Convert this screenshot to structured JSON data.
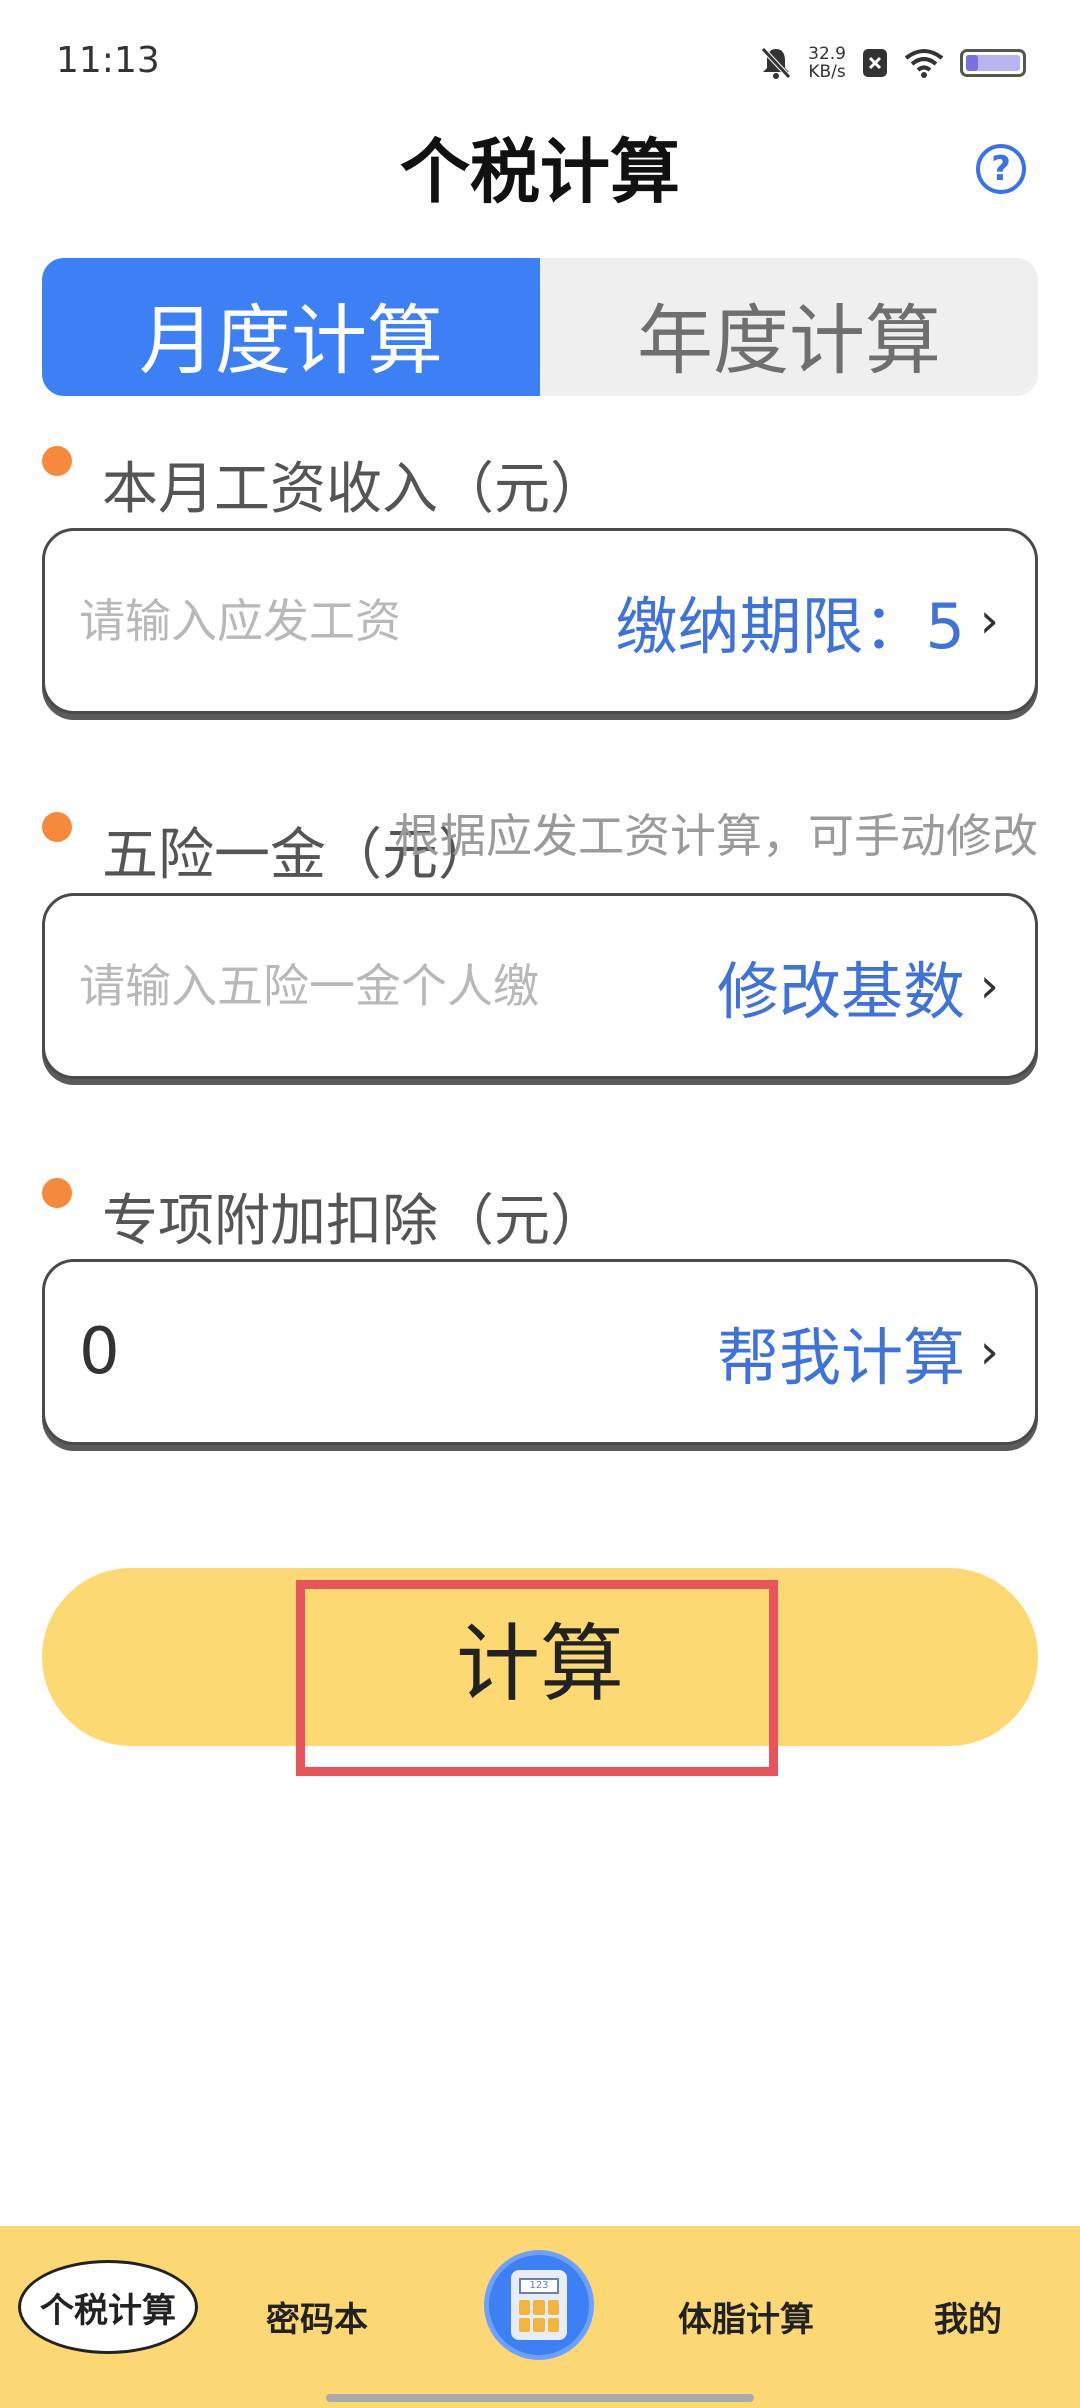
{
  "status_bar": {
    "time": "11:13",
    "speed_value": "32.9",
    "speed_unit": "KB/s"
  },
  "header": {
    "title": "个税计算",
    "help": "?"
  },
  "tabs": [
    {
      "label": "月度计算",
      "active": true
    },
    {
      "label": "年度计算",
      "active": false
    }
  ],
  "salary": {
    "label": "本月工资收入（元）",
    "placeholder": "请输入应发工资",
    "action": "缴纳期限：5"
  },
  "insurance": {
    "label": "五险一金（元）",
    "hint": "根据应发工资计算，可手动修改",
    "placeholder": "请输入五险一金个人缴",
    "action": "修改基数"
  },
  "deduction": {
    "label": "专项附加扣除（元）",
    "value": "0",
    "action": "帮我计算"
  },
  "calculate_button": "计算",
  "bottom_nav": {
    "items": [
      "个税计算",
      "密码本",
      "体脂计算",
      "我的"
    ],
    "center_icon_text": "123"
  },
  "colors": {
    "accent": "#3d7ff5",
    "button": "#fdd974",
    "dot": "#f58a3c",
    "highlight": "#e9535b"
  }
}
